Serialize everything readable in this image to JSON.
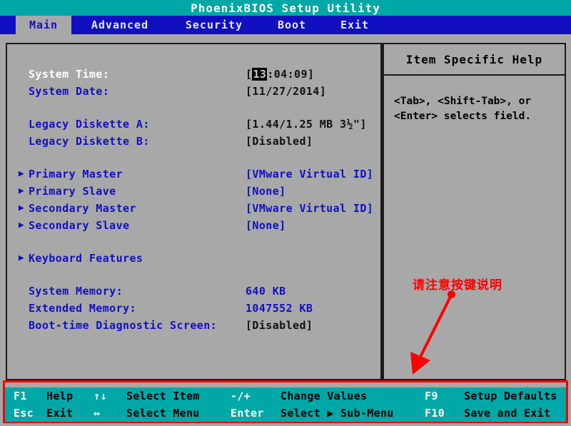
{
  "window": {
    "title": "PhoenixBIOS Setup Utility"
  },
  "menubar": {
    "tabs": [
      {
        "label": "Main",
        "selected": true
      },
      {
        "label": "Advanced",
        "selected": false
      },
      {
        "label": "Security",
        "selected": false
      },
      {
        "label": "Boot",
        "selected": false
      },
      {
        "label": "Exit",
        "selected": false
      }
    ]
  },
  "main": {
    "rows": [
      {
        "label": "System Time:",
        "value_prefix": "[",
        "value_selected": "13",
        "value_suffix": ":04:09]",
        "active": true
      },
      {
        "label": "System Date:",
        "value": "[11/27/2014]"
      },
      {
        "label": "Legacy Diskette A:",
        "value": "[1.44/1.25 MB  3½\"]"
      },
      {
        "label": "Legacy Diskette B:",
        "value": "[Disabled]"
      },
      {
        "label": "Primary Master",
        "value": "[VMware Virtual ID]",
        "bullet": "▶",
        "value_blue": true
      },
      {
        "label": "Primary Slave",
        "value": "[None]",
        "bullet": "▶",
        "value_blue": true
      },
      {
        "label": "Secondary Master",
        "value": "[VMware Virtual ID]",
        "bullet": "▶",
        "value_blue": true
      },
      {
        "label": "Secondary Slave",
        "value": "[None]",
        "bullet": "▶",
        "value_blue": true
      },
      {
        "label": "Keyboard Features",
        "value": "",
        "bullet": "▶"
      },
      {
        "label": "System Memory:",
        "value": "640 KB",
        "value_blue": true
      },
      {
        "label": "Extended Memory:",
        "value": "1047552 KB",
        "value_blue": true
      },
      {
        "label": "Boot-time Diagnostic Screen:",
        "value": "[Disabled]"
      }
    ]
  },
  "help": {
    "title": "Item Specific Help",
    "line1": "<Tab>, <Shift-Tab>, or",
    "line2": "<Enter> selects field."
  },
  "annotation": {
    "text": "请注意按键说明",
    "color": "#ff0000"
  },
  "keybar": {
    "row1": [
      {
        "key": "F1",
        "desc": "Help"
      },
      {
        "key": "↑↓",
        "desc": "Select Item"
      },
      {
        "key": "-/+",
        "desc": "Change Values"
      },
      {
        "key": "F9",
        "desc": "Setup Defaults"
      }
    ],
    "row2": [
      {
        "key": "Esc",
        "desc": "Exit"
      },
      {
        "key": "↔",
        "desc": "Select Menu"
      },
      {
        "key": "Enter",
        "desc": "Select ▶ Sub-Menu"
      },
      {
        "key": "F10",
        "desc": "Save and Exit"
      }
    ]
  },
  "colors": {
    "teal": "#00a7a7",
    "blue": "#1010c0",
    "gray": "#a8a8a8",
    "red": "#ff0000"
  }
}
